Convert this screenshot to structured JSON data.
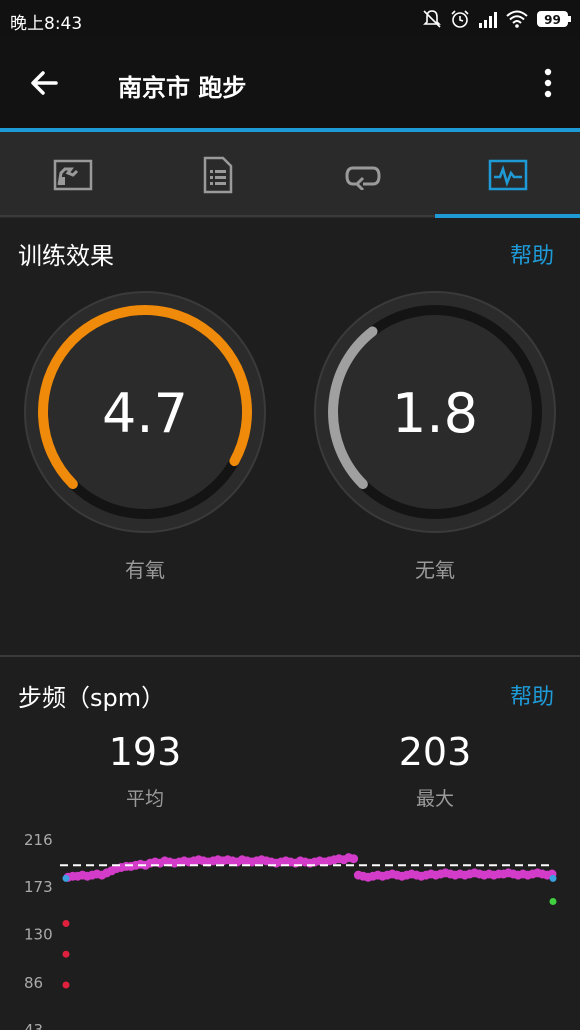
{
  "status_bar": {
    "time": "晚上8:43",
    "battery": "99"
  },
  "app_bar": {
    "title": "南京市 跑步"
  },
  "tabs": [
    {
      "icon": "map-icon"
    },
    {
      "icon": "details-list-icon"
    },
    {
      "icon": "laps-icon"
    },
    {
      "icon": "stats-chart-icon",
      "selected": true
    }
  ],
  "training_effect": {
    "title": "训练效果",
    "help": "帮助",
    "aerobic": {
      "value": "4.7",
      "label": "有氧",
      "fraction": 0.94,
      "color": "#f08a0a"
    },
    "anaerobic": {
      "value": "1.8",
      "label": "无氧",
      "fraction": 0.36,
      "color": "#a0a0a0"
    }
  },
  "cadence": {
    "title": "步频（spm）",
    "help": "帮助",
    "average": {
      "value": "193",
      "label": "平均"
    },
    "max": {
      "value": "203",
      "label": "最大"
    }
  },
  "chart_data": {
    "type": "scatter",
    "y_ticks": [
      "216",
      "173",
      "130",
      "86",
      "43"
    ],
    "ylim": [
      43,
      216
    ],
    "average_line": 193,
    "series_color": "#d23cc8",
    "series": [
      {
        "x": [
          0.0,
          0.01,
          0.02,
          0.03,
          0.04,
          0.05,
          0.06,
          0.07,
          0.08,
          0.09,
          0.1,
          0.11,
          0.12,
          0.13,
          0.14,
          0.15,
          0.16,
          0.17,
          0.18,
          0.19,
          0.2,
          0.21,
          0.22,
          0.23,
          0.24,
          0.25,
          0.26,
          0.27,
          0.28,
          0.29,
          0.3,
          0.31,
          0.32,
          0.33,
          0.34,
          0.35,
          0.36,
          0.37,
          0.38,
          0.39,
          0.4,
          0.41,
          0.42,
          0.43,
          0.44,
          0.45,
          0.46,
          0.47,
          0.48,
          0.49,
          0.5,
          0.51,
          0.52,
          0.53,
          0.54,
          0.55,
          0.56,
          0.57,
          0.58,
          0.59,
          0.6,
          0.61,
          0.62,
          0.63,
          0.64,
          0.65,
          0.66,
          0.67,
          0.68,
          0.69,
          0.7,
          0.71,
          0.72,
          0.73,
          0.74,
          0.75,
          0.76,
          0.77,
          0.78,
          0.79,
          0.8,
          0.81,
          0.82,
          0.83,
          0.84,
          0.85,
          0.86,
          0.87,
          0.88,
          0.89,
          0.9,
          0.91,
          0.92,
          0.93,
          0.94,
          0.95,
          0.96,
          0.97,
          0.98,
          0.99,
          1.0
        ],
        "y": [
          182,
          183,
          183,
          184,
          183,
          184,
          185,
          184,
          186,
          188,
          190,
          191,
          192,
          192,
          193,
          194,
          193,
          195,
          196,
          195,
          197,
          196,
          195,
          196,
          197,
          196,
          197,
          198,
          197,
          196,
          197,
          198,
          197,
          198,
          197,
          196,
          198,
          197,
          196,
          197,
          198,
          197,
          196,
          195,
          196,
          197,
          196,
          195,
          197,
          196,
          195,
          196,
          197,
          196,
          197,
          198,
          199,
          198,
          200,
          199,
          184,
          183,
          182,
          183,
          184,
          183,
          184,
          185,
          184,
          183,
          184,
          185,
          184,
          183,
          184,
          185,
          184,
          185,
          186,
          185,
          184,
          185,
          184,
          185,
          186,
          185,
          184,
          185,
          184,
          185,
          185,
          186,
          185,
          184,
          185,
          184,
          185,
          186,
          185,
          184,
          185
        ]
      }
    ],
    "outliers": [
      {
        "x": 0.0,
        "y": 140,
        "color": "#e0203c"
      },
      {
        "x": 0.0,
        "y": 112,
        "color": "#e0203c"
      },
      {
        "x": 0.0,
        "y": 84,
        "color": "#e0203c"
      },
      {
        "x": 0.0,
        "y": 181,
        "color": "#3aa0e0"
      },
      {
        "x": 1.0,
        "y": 181,
        "color": "#3aa0e0"
      },
      {
        "x": 1.0,
        "y": 160,
        "color": "#40d040"
      }
    ]
  }
}
